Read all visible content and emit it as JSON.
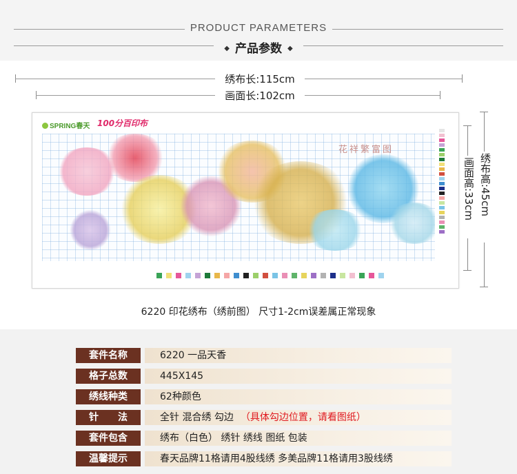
{
  "header": {
    "title_en": "PRODUCT PARAMETERS",
    "title_cn": "产品参数",
    "diamond": "◆"
  },
  "dimensions": {
    "cloth_length": "绣布长:115cm",
    "image_length": "画面长:102cm",
    "cloth_height": "绣布高:45cm",
    "image_height": "画面高:33cm"
  },
  "pattern": {
    "logo_spring": "SPRING春天",
    "logo_brand": "100分百印布",
    "seal_text": "花祥繁富图"
  },
  "caption": "6220 印花绣布（绣前图） 尺寸1-2cm误差属正常现象",
  "specs": [
    {
      "label": "套件名称",
      "value": "6220  一品天香",
      "note": ""
    },
    {
      "label": "格子总数",
      "value": "445X145",
      "note": ""
    },
    {
      "label": "绣线种类",
      "value": "62种颜色",
      "note": ""
    },
    {
      "label": "针　　法",
      "value": "全针  混合绣  勾边",
      "note": "（具体勾边位置，请看图纸）"
    },
    {
      "label": "套件包含",
      "value": "绣布（白色）   绣针   绣线   图纸   包装",
      "note": ""
    },
    {
      "label": "温馨提示",
      "value": "春天品牌11格请用4股线绣    多美品牌11格请用3股线绣",
      "note": ""
    }
  ],
  "colors": {
    "label_bg": "#6b3121",
    "note_red": "#e0191e",
    "accent_green": "#4a9a2a",
    "brand_pink": "#e02a6a"
  }
}
